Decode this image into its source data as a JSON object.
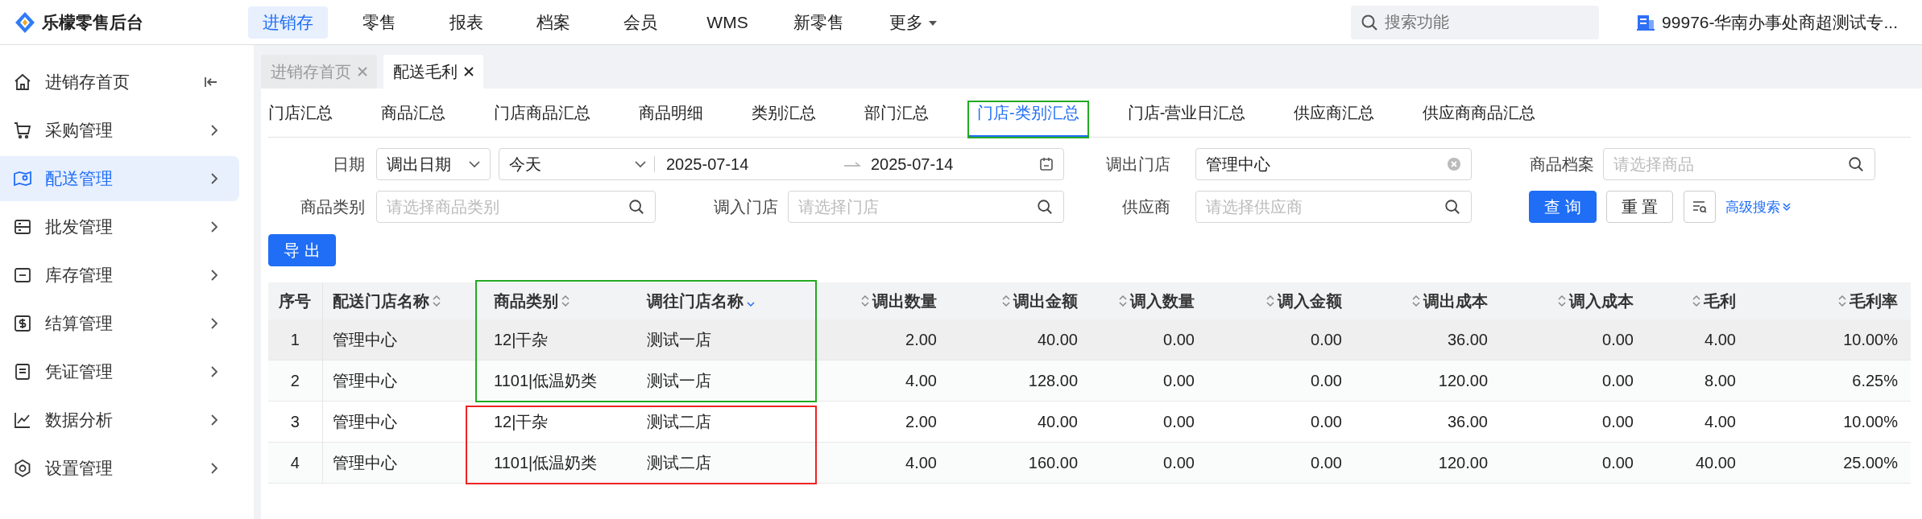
{
  "app": {
    "logo_text": "乐檬零售后台"
  },
  "top_nav": [
    {
      "label": "进销存",
      "selected": true,
      "kind": "link"
    },
    {
      "label": "零售",
      "selected": false,
      "kind": "link"
    },
    {
      "label": "报表",
      "selected": false,
      "kind": "link"
    },
    {
      "label": "档案",
      "selected": false,
      "kind": "link"
    },
    {
      "label": "会员",
      "selected": false,
      "kind": "link"
    },
    {
      "label": "WMS",
      "selected": false,
      "kind": "link"
    },
    {
      "label": "新零售",
      "selected": false,
      "kind": "link"
    },
    {
      "label": "更多",
      "selected": false,
      "kind": "dropdown"
    }
  ],
  "search": {
    "placeholder": "搜索功能"
  },
  "store": "99976-华南办事处商超测试专...",
  "sidebar": {
    "collapse_button": true,
    "items": [
      {
        "label": "进销存首页",
        "kind": "home",
        "selected": false,
        "expandable": false
      },
      {
        "label": "采购管理",
        "kind": "cart",
        "selected": false,
        "expandable": true
      },
      {
        "label": "配送管理",
        "kind": "map",
        "selected": true,
        "expandable": true
      },
      {
        "label": "批发管理",
        "kind": "server",
        "selected": false,
        "expandable": true
      },
      {
        "label": "库存管理",
        "kind": "box",
        "selected": false,
        "expandable": true
      },
      {
        "label": "结算管理",
        "kind": "money",
        "selected": false,
        "expandable": true
      },
      {
        "label": "凭证管理",
        "kind": "doc",
        "selected": false,
        "expandable": true
      },
      {
        "label": "数据分析",
        "kind": "chart",
        "selected": false,
        "expandable": true
      },
      {
        "label": "设置管理",
        "kind": "gear",
        "selected": false,
        "expandable": true
      }
    ]
  },
  "page_tabs": [
    {
      "label": "进销存首页",
      "selected": false
    },
    {
      "label": "配送毛利",
      "selected": true
    }
  ],
  "sub_tabs": [
    {
      "label": "门店汇总",
      "selected": false
    },
    {
      "label": "商品汇总",
      "selected": false
    },
    {
      "label": "门店商品汇总",
      "selected": false
    },
    {
      "label": "商品明细",
      "selected": false
    },
    {
      "label": "类别汇总",
      "selected": false
    },
    {
      "label": "部门汇总",
      "selected": false
    },
    {
      "label": "门店-类别汇总",
      "selected": true
    },
    {
      "label": "门店-营业日汇总",
      "selected": false
    },
    {
      "label": "供应商汇总",
      "selected": false
    },
    {
      "label": "供应商商品汇总",
      "selected": false
    }
  ],
  "filters": {
    "date": {
      "label": "日期",
      "type_value": "调出日期",
      "preset": "今天",
      "start": "2025-07-14",
      "end": "2025-07-14"
    },
    "out_store": {
      "label": "调出门店",
      "value": "管理中心"
    },
    "product": {
      "label": "商品档案",
      "placeholder": "请选择商品"
    },
    "category": {
      "label": "商品类别",
      "placeholder": "请选择商品类别"
    },
    "in_store": {
      "label": "调入门店",
      "placeholder": "请选择门店"
    },
    "supplier": {
      "label": "供应商",
      "placeholder": "请选择供应商"
    }
  },
  "buttons": {
    "query": "查 询",
    "reset": "重 置",
    "advanced": "高级搜索",
    "export": "导 出"
  },
  "table": {
    "columns": [
      {
        "label": "序号"
      },
      {
        "label": "配送门店名称",
        "sorted_desc": false
      },
      {
        "label": "商品类别",
        "sorted_desc": false
      },
      {
        "label": "调往门店名称",
        "sorted_desc": true
      },
      {
        "label": "调出数量",
        "sorted_desc": false
      },
      {
        "label": "调出金额",
        "sorted_desc": false
      },
      {
        "label": "调入数量",
        "sorted_desc": false
      },
      {
        "label": "调入金额",
        "sorted_desc": false
      },
      {
        "label": "调出成本",
        "sorted_desc": false
      },
      {
        "label": "调入成本",
        "sorted_desc": false
      },
      {
        "label": "毛利",
        "sorted_desc": false
      },
      {
        "label": "毛利率",
        "sorted_desc": false
      }
    ],
    "rows": [
      {
        "highlighted": true,
        "cells": [
          "1",
          "管理中心",
          "12|干杂",
          "测试一店",
          "2.00",
          "40.00",
          "0.00",
          "0.00",
          "36.00",
          "0.00",
          "4.00",
          "10.00%"
        ]
      },
      {
        "highlighted": false,
        "cells": [
          "2",
          "管理中心",
          "1101|低温奶类",
          "测试一店",
          "4.00",
          "128.00",
          "0.00",
          "0.00",
          "120.00",
          "0.00",
          "8.00",
          "6.25%"
        ]
      },
      {
        "highlighted": false,
        "cells": [
          "3",
          "管理中心",
          "12|干杂",
          "测试二店",
          "2.00",
          "40.00",
          "0.00",
          "0.00",
          "36.00",
          "0.00",
          "4.00",
          "10.00%"
        ]
      },
      {
        "highlighted": false,
        "cells": [
          "4",
          "管理中心",
          "1101|低温奶类",
          "测试二店",
          "4.00",
          "160.00",
          "0.00",
          "0.00",
          "120.00",
          "0.00",
          "40.00",
          "25.00%"
        ]
      }
    ]
  }
}
